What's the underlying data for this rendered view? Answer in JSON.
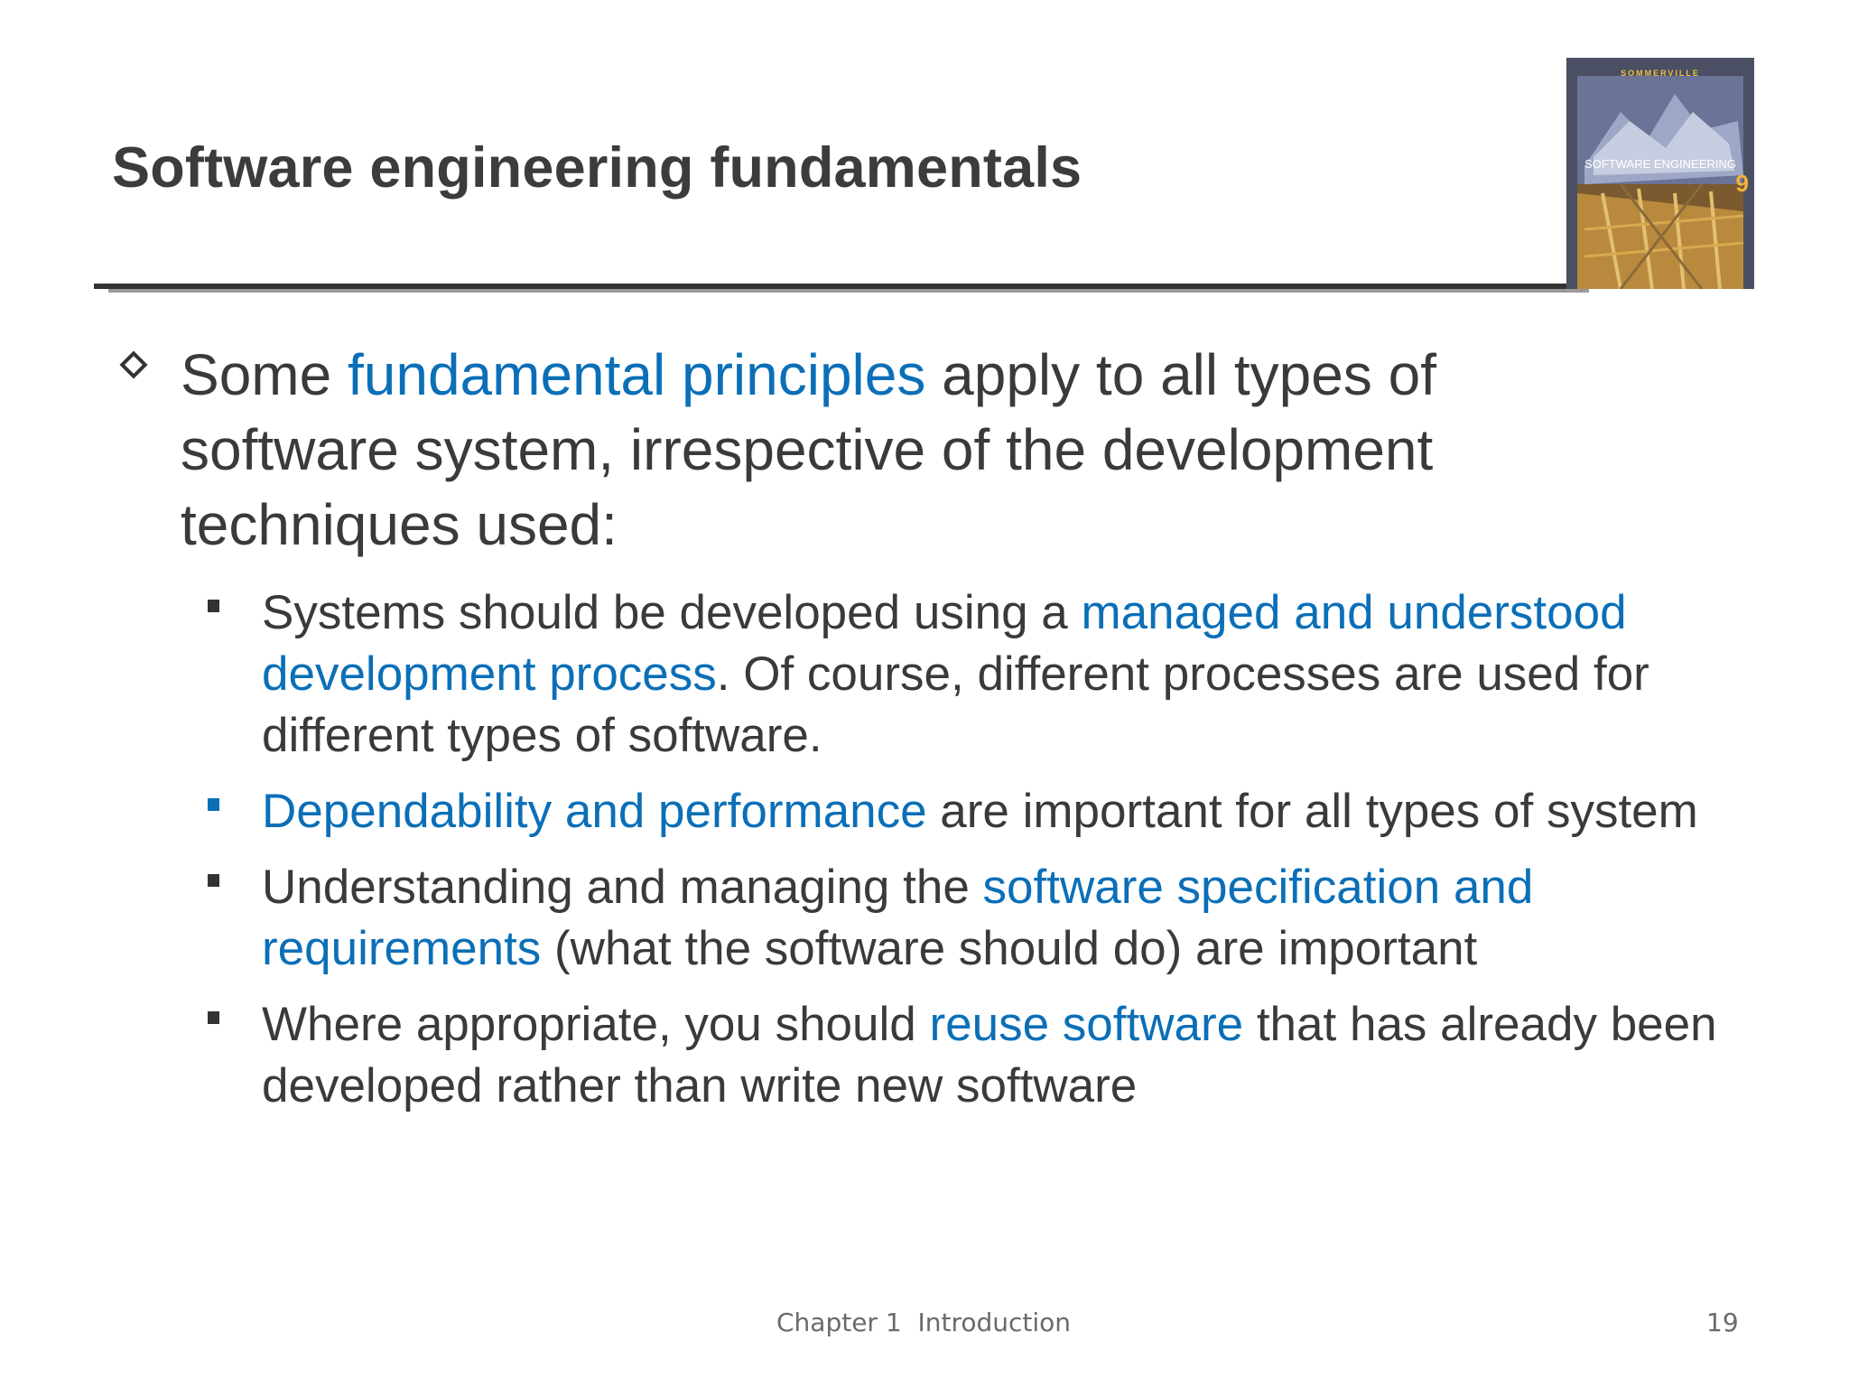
{
  "slide": {
    "title": "Software engineering fundamentals",
    "cover": {
      "author": "SOMMERVILLE",
      "title": "SOFTWARE ENGINEERING",
      "edition": "9"
    },
    "main_bullet": {
      "t1": "Some ",
      "h1": "fundamental principles",
      "t2": " apply to all types of software system, irrespective of the development techniques used:"
    },
    "sub_bullets": [
      {
        "t1": "Systems should be developed using a ",
        "h1": "managed and understood development process",
        "t2": ". Of course, different processes are used for different types of software."
      },
      {
        "h1": "Dependability and performance",
        "t2": " are important for all types of system"
      },
      {
        "t1": "Understanding and managing the ",
        "h1": "software specification and requirements",
        "t2": " (what the software should do) are important"
      },
      {
        "t1": "Where appropriate, you should ",
        "h1": "reuse software",
        "t2": " that has already been developed rather than write new software"
      }
    ],
    "footer": {
      "chapter": "Chapter 1  Introduction",
      "page": "19"
    }
  },
  "colors": {
    "highlight": "#0b6fb7",
    "text": "#3a3a3a",
    "rule": "#333333"
  },
  "icons": {
    "main_bullet": "hollow-diamond-icon",
    "sub_bullet": "square-bullet-icon"
  }
}
